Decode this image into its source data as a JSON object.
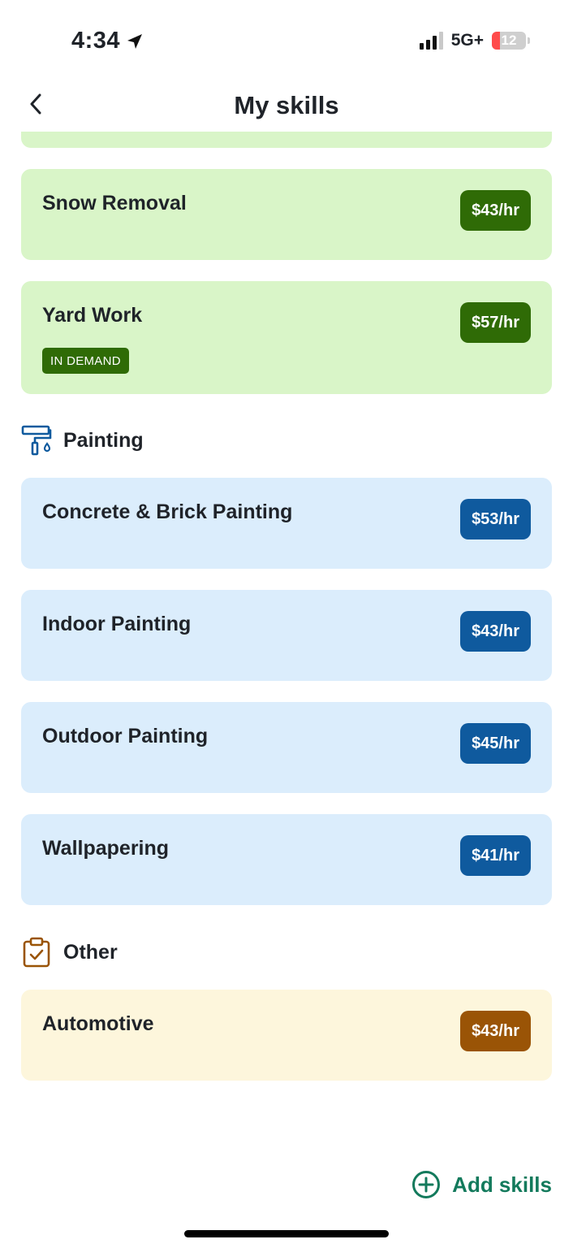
{
  "status_bar": {
    "time": "4:34",
    "network": "5G+",
    "battery": "12"
  },
  "header": {
    "title": "My skills"
  },
  "groups": {
    "outdoor": {
      "skills": [
        {
          "name": "Snow Removal",
          "rate": "$43/hr"
        },
        {
          "name": "Yard Work",
          "rate": "$57/hr",
          "badge": "IN DEMAND"
        }
      ]
    },
    "painting": {
      "title": "Painting",
      "skills": [
        {
          "name": "Concrete & Brick Painting",
          "rate": "$53/hr"
        },
        {
          "name": "Indoor Painting",
          "rate": "$43/hr"
        },
        {
          "name": "Outdoor Painting",
          "rate": "$45/hr"
        },
        {
          "name": "Wallpapering",
          "rate": "$41/hr"
        }
      ]
    },
    "other": {
      "title": "Other",
      "skills": [
        {
          "name": "Automotive",
          "rate": "$43/hr"
        }
      ]
    }
  },
  "actions": {
    "add_skills": "Add skills"
  },
  "colors": {
    "green_card": "#d9f5c8",
    "green_accent": "#2f6b06",
    "blue_card": "#dbedfc",
    "blue_accent": "#0f5a9e",
    "yellow_card": "#fdf6dc",
    "brown_accent": "#9a5406",
    "add_accent": "#137a5c"
  }
}
